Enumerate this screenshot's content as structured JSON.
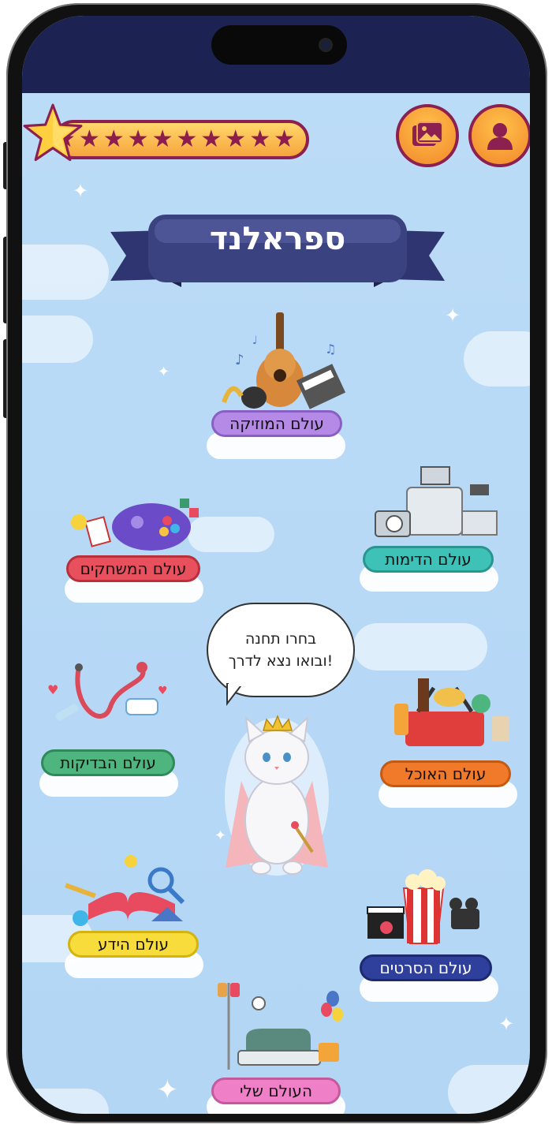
{
  "header": {
    "stars_count": 10,
    "star_glyph": "★",
    "gallery_icon": "image-gallery-icon",
    "profile_icon": "user-profile-icon"
  },
  "title": "ספראלנד",
  "speech_bubble": {
    "line1": "בחרו תחנה",
    "line2": "ובואו נצא לדרך!"
  },
  "stations": {
    "music": "עולם המוזיקה",
    "games": "עולם המשחקים",
    "imaging": "עולם הדימות",
    "tests": "עולם הבדיקות",
    "food": "עולם האוכל",
    "knowledge": "עולם הידע",
    "movies": "עולם הסרטים",
    "mine": "העולם שלי"
  },
  "colors": {
    "sky": "#b7d9f6",
    "status_bar": "#1c2352",
    "ribbon": "#3b4280",
    "music_plate": "#b48ae6",
    "games_plate": "#e8505e",
    "imaging_plate": "#3ec2b8",
    "tests_plate": "#4fb57f",
    "food_plate": "#f07a2a",
    "knowledge_plate": "#f7dc3c",
    "movies_plate": "#2e3f9c",
    "mine_plate": "#ef7fc6"
  }
}
